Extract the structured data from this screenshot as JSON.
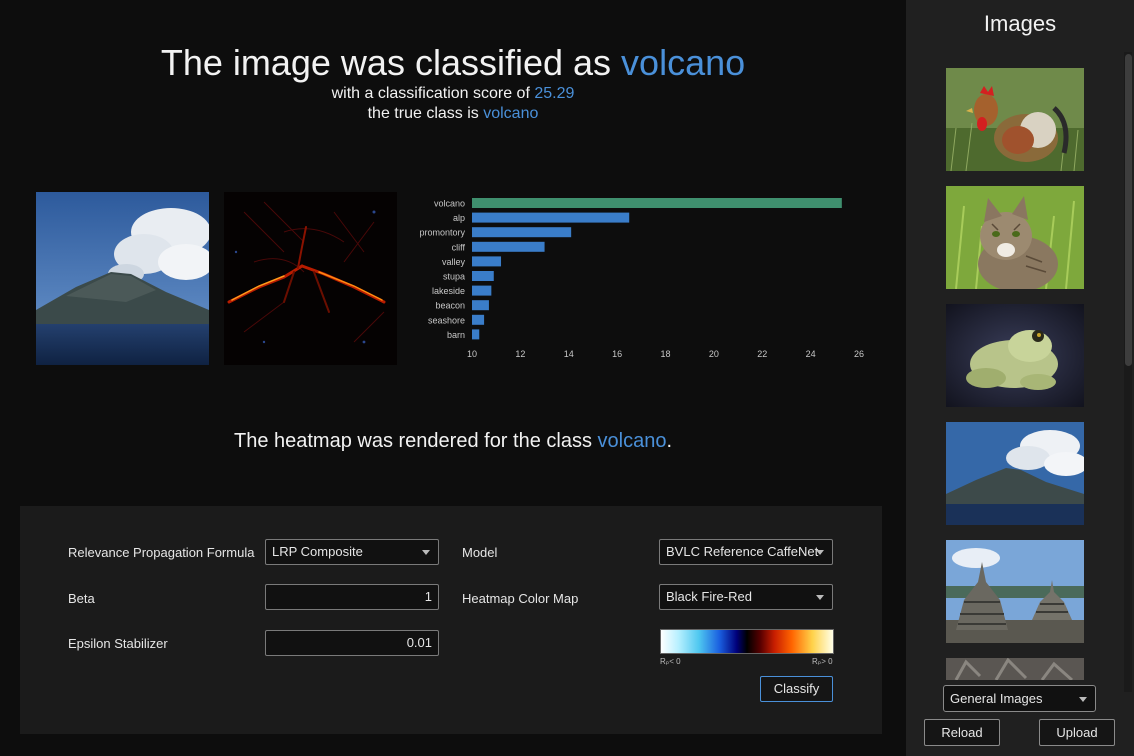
{
  "result": {
    "prefix": "The image was classified as ",
    "predicted_class": "volcano",
    "score_prefix": "with a classification score of ",
    "score": "25.29",
    "true_prefix": "the true class is ",
    "true_class": "volcano",
    "heatmap_prefix": "The heatmap was rendered for the class ",
    "heatmap_class": "volcano",
    "heatmap_suffix": "."
  },
  "chart_data": {
    "type": "bar",
    "orientation": "horizontal",
    "categories": [
      "volcano",
      "alp",
      "promontory",
      "cliff",
      "valley",
      "stupa",
      "lakeside",
      "beacon",
      "seashore",
      "barn"
    ],
    "values": [
      25.29,
      16.5,
      14.1,
      13.0,
      11.2,
      10.9,
      10.8,
      10.7,
      10.5,
      10.3
    ],
    "xlim": [
      10,
      26
    ],
    "xticks": [
      10,
      12,
      14,
      16,
      18,
      20,
      22,
      24,
      26
    ],
    "colors": {
      "top": "#3f8f6e",
      "other": "#3a7dc9"
    }
  },
  "settings": {
    "formula_label": "Relevance Propagation Formula",
    "formula_value": "LRP Composite",
    "model_label": "Model",
    "model_value": "BVLC Reference CaffeNet",
    "beta_label": "Beta",
    "beta_value": "1",
    "colormap_label": "Heatmap Color Map",
    "colormap_value": "Black Fire-Red",
    "epsilon_label": "Epsilon Stabilizer",
    "epsilon_value": "0.01",
    "cm_neg_label": "Rₚ< 0",
    "cm_pos_label": "Rₚ> 0",
    "classify_label": "Classify"
  },
  "sidebar": {
    "title": "Images",
    "thumbnails": [
      "rooster",
      "cat",
      "frog",
      "volcano",
      "stupa",
      "stone carving"
    ],
    "set_value": "General Images",
    "reload_label": "Reload",
    "upload_label": "Upload"
  },
  "colors": {
    "accent": "#4a90d9",
    "background": "#0d0d0d",
    "sidebar": "#202020",
    "panel": "#1b1b1b"
  }
}
